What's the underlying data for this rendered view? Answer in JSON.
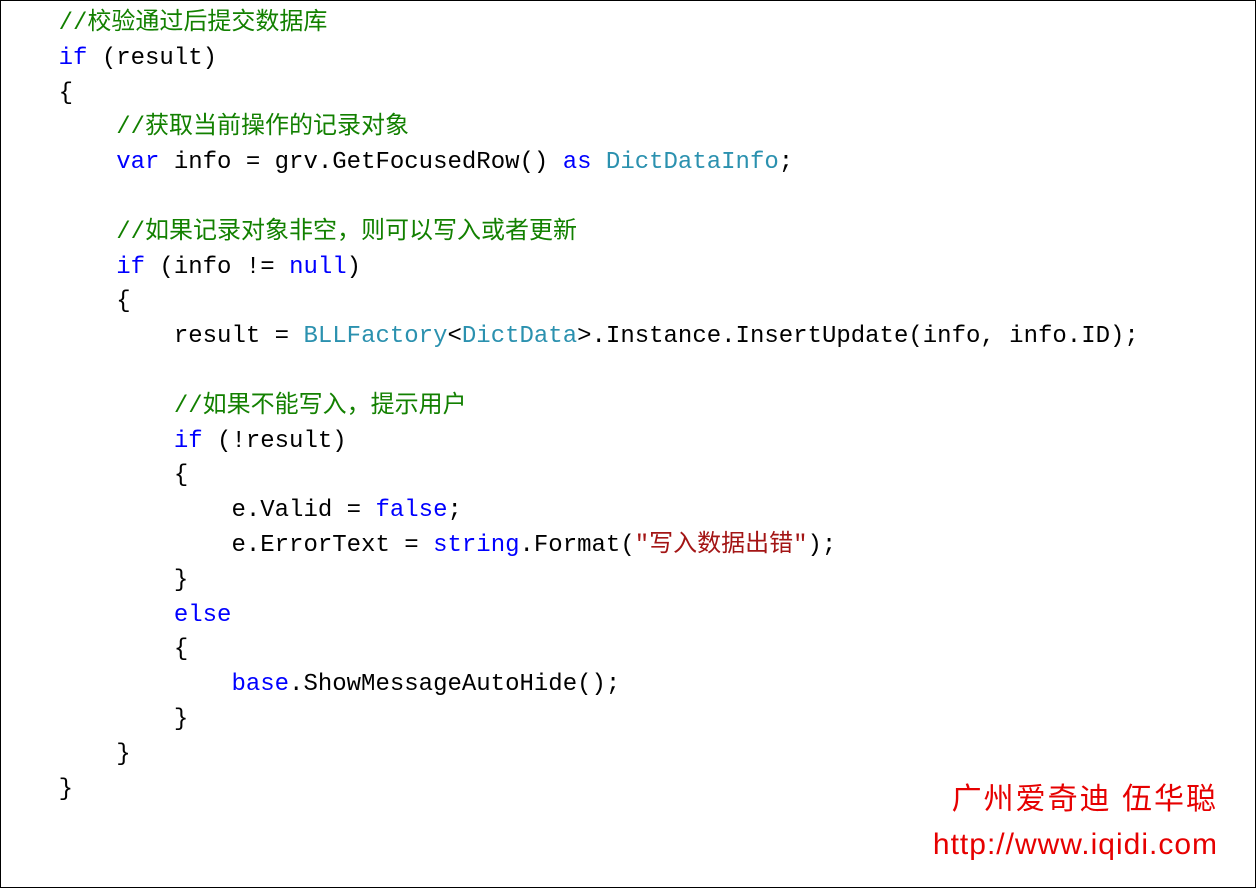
{
  "code": {
    "indent1": "    ",
    "indent2": "        ",
    "indent3": "            ",
    "indent4": "                ",
    "indent5": "                    ",
    "line01_comment": "//校验通过后提交数据库",
    "line02_kw": "if",
    "line02_rest": " (result)",
    "line03": "{",
    "line04_comment": "//获取当前操作的记录对象",
    "line05_kw1": "var",
    "line05_mid": " info = grv.GetFocusedRow() ",
    "line05_kw2": "as",
    "line05_sp": " ",
    "line05_type": "DictDataInfo",
    "line05_end": ";",
    "blank": "",
    "line07_comment": "//如果记录对象非空，则可以写入或者更新",
    "line08_kw": "if",
    "line08_mid": " (info != ",
    "line08_kw2": "null",
    "line08_end": ")",
    "line09": "{",
    "line10_a": "result = ",
    "line10_type1": "BLLFactory",
    "line10_b": "<",
    "line10_type2": "DictData",
    "line10_c": ">.Instance.InsertUpdate(info, info.ID);",
    "line12_comment": "//如果不能写入，提示用户",
    "line13_kw": "if",
    "line13_rest": " (!result)",
    "line14": "{",
    "line15_a": "e.Valid = ",
    "line15_kw": "false",
    "line15_b": ";",
    "line16_a": "e.ErrorText = ",
    "line16_kw": "string",
    "line16_b": ".Format(",
    "line16_str": "\"写入数据出错\"",
    "line16_c": ");",
    "line17": "}",
    "line18_kw": "else",
    "line19": "{",
    "line20_kw": "base",
    "line20_rest": ".ShowMessageAutoHide();",
    "line21": "}",
    "line22": "}",
    "line23": "}"
  },
  "watermark": {
    "line1": "广州爱奇迪 伍华聪",
    "line2": "http://www.iqidi.com"
  }
}
